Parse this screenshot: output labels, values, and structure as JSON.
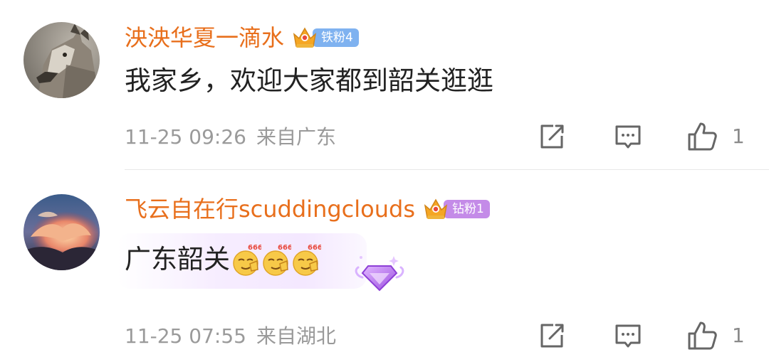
{
  "comments": [
    {
      "username": "泱泱华夏一滴水",
      "badge": {
        "label": "铁粉4",
        "tier": "iron",
        "color": "#7fb2f0",
        "crown_icon": "crown-icon"
      },
      "content": "我家乡，欢迎大家都到韶关逛逛",
      "time": "11-25 09:26",
      "location": "来自广东",
      "likes": "1",
      "avatar_icon": "wolf-avatar"
    },
    {
      "username": "飞云自在行scuddingclouds",
      "badge": {
        "label": "钻粉1",
        "tier": "diamond",
        "color": "#c48be8",
        "crown_icon": "crown-icon"
      },
      "content": "广东韶关",
      "emojis": [
        "666-emoji",
        "666-emoji",
        "666-emoji"
      ],
      "emoji_caption": "666",
      "time": "11-25 07:55",
      "location": "来自湖北",
      "likes": "1",
      "avatar_icon": "sunset-clouds-avatar",
      "decoration_icon": "purple-diamond-icon"
    }
  ],
  "colors": {
    "username": "#e86f1c",
    "meta_text": "#9a9a9a",
    "content_text": "#222222",
    "icon_stroke": "#666666"
  }
}
